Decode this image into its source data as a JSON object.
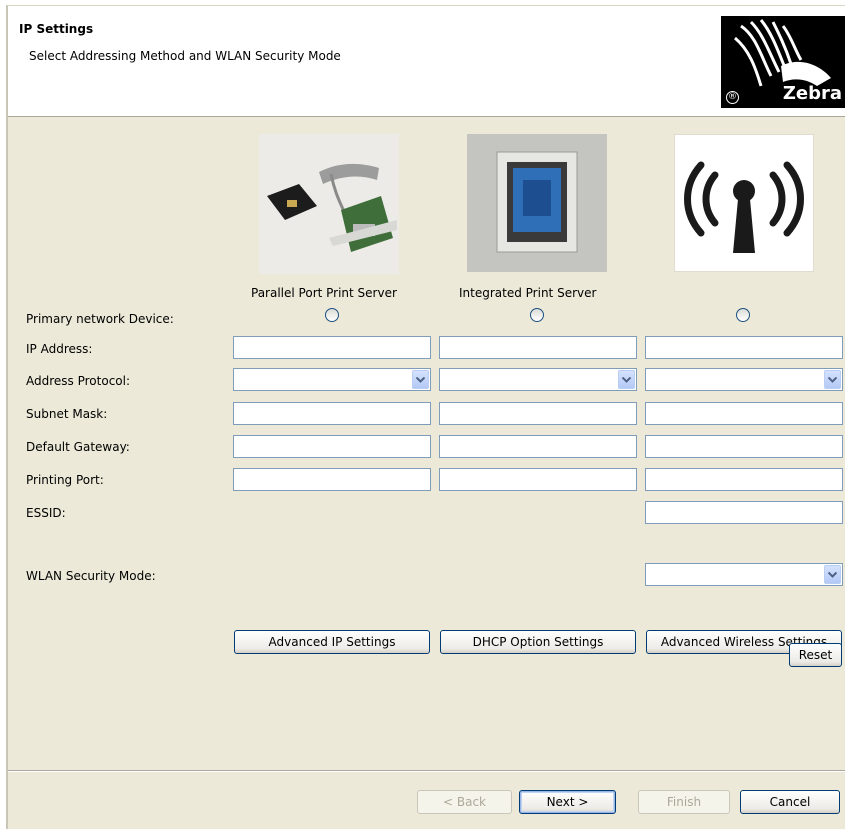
{
  "header": {
    "title": "IP Settings",
    "subtitle": "Select Addressing Method and WLAN Security Mode",
    "logo_text": "Zebra",
    "logo_reg": "®"
  },
  "devices": [
    {
      "caption": "Parallel Port Print Server",
      "image": "parallel-port-print-server-photo"
    },
    {
      "caption": "Integrated Print Server",
      "image": "ethernet-port-photo"
    },
    {
      "caption": "",
      "image": "wireless-antenna-icon"
    }
  ],
  "labels": {
    "primary": "Primary network Device:",
    "ip": "IP Address:",
    "protocol": "Address Protocol:",
    "subnet": "Subnet Mask:",
    "gateway": "Default Gateway:",
    "port": "Printing Port:",
    "essid": "ESSID:",
    "wlan": "WLAN Security Mode:"
  },
  "fields": {
    "ip": [
      "",
      "",
      ""
    ],
    "protocol": [
      "",
      "",
      ""
    ],
    "subnet": [
      "",
      "",
      ""
    ],
    "gateway": [
      "",
      "",
      ""
    ],
    "port": [
      "",
      "",
      ""
    ],
    "essid": "",
    "wlan_mode": ""
  },
  "buttons": {
    "advanced_ip": "Advanced IP Settings",
    "dhcp": "DHCP Option Settings",
    "advanced_wireless": "Advanced Wireless Settings",
    "reset": "Reset",
    "back": "< Back",
    "next": "Next >",
    "finish": "Finish",
    "cancel": "Cancel"
  },
  "colors": {
    "dialog_bg": "#ece9d8",
    "field_border": "#7f9db9",
    "dropdown_arrow": "#4d6185"
  }
}
